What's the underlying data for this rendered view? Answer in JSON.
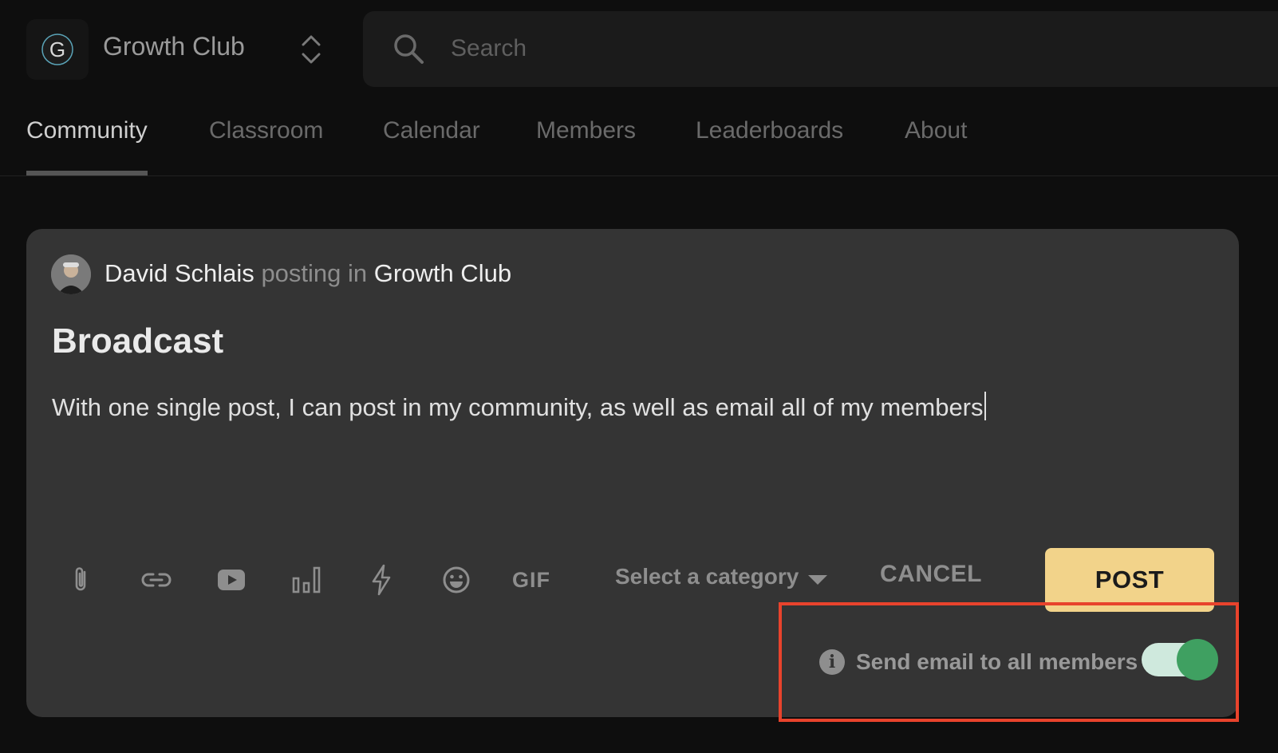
{
  "header": {
    "logo_letter": "G",
    "club_name": "Growth Club",
    "search_placeholder": "Search"
  },
  "tabs": [
    {
      "label": "Community",
      "active": true
    },
    {
      "label": "Classroom",
      "active": false
    },
    {
      "label": "Calendar",
      "active": false
    },
    {
      "label": "Members",
      "active": false
    },
    {
      "label": "Leaderboards",
      "active": false
    },
    {
      "label": "About",
      "active": false
    }
  ],
  "composer": {
    "author": "David Schlais",
    "posting_in": "posting in",
    "group": "Growth Club",
    "title": "Broadcast",
    "body": "With one single post, I can post in my community, as well as email all of my members",
    "toolbar": {
      "icons": [
        "attachment-icon",
        "link-icon",
        "youtube-icon",
        "poll-icon",
        "lightning-icon",
        "emoji-icon",
        "gif-icon"
      ],
      "gif_label": "GIF",
      "category_placeholder": "Select a category",
      "cancel_label": "CANCEL",
      "post_label": "POST"
    },
    "email_option": {
      "label": "Send email to all members",
      "enabled": true
    }
  },
  "colors": {
    "page_bg": "#0e0e0e",
    "card_bg": "#343434",
    "post_button": "#f2d38a",
    "toggle_on": "#3fa061",
    "highlight": "#e8432c"
  }
}
